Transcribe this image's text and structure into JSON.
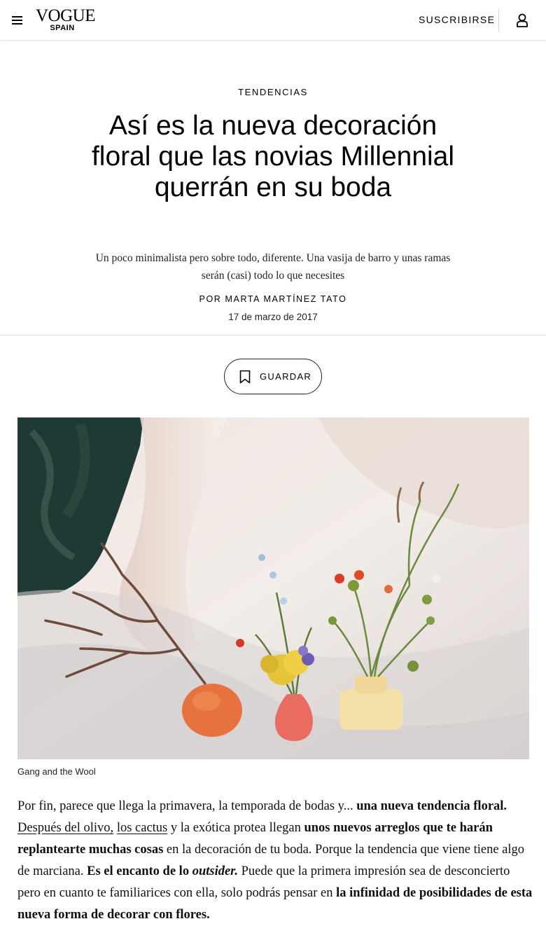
{
  "header": {
    "logo_main": "VOGUE",
    "logo_sub": "SPAIN",
    "subscribe_label": "SUSCRIBIRSE"
  },
  "article": {
    "rubric": "TENDENCIAS",
    "headline": "Así es la nueva decoración floral que las novias Millennial querrán en su boda",
    "dek": "Un poco minimalista pero sobre todo, diferente. Una vasija de barro y unas ramas serán (casi) todo lo que necesites",
    "byline": "POR MARTA MARTÍNEZ TATO",
    "date": "17 de marzo de 2017",
    "save_label": "GUARDAR",
    "image_caption": "Gang and the Wool",
    "body": {
      "s1": "Por fin, parece que llega la primavera, la temporada de bodas y... ",
      "s2": "una nueva tendencia floral.",
      "s3": " ",
      "link1": "Después del olivo,",
      "s4": " ",
      "link2": "los cactus",
      "s5": " y la exótica protea llegan ",
      "s6": "unos nuevos arreglos que te harán replantearte muchas cosas",
      "s7": " en la decoración de tu boda. Porque la tendencia que viene tiene algo de marciana. ",
      "s8": "Es el encanto de lo ",
      "s9": "outsider.",
      "s10": " Puede que la primera impresión sea de desconcierto pero en cuanto te familiarices con ella, solo podrás pensar en ",
      "s11": "la infinidad de posibilidades de esta nueva forma de decorar con flores."
    }
  },
  "icons": {
    "menu": "hamburger-icon",
    "user": "user-icon",
    "bookmark": "bookmark-icon"
  }
}
